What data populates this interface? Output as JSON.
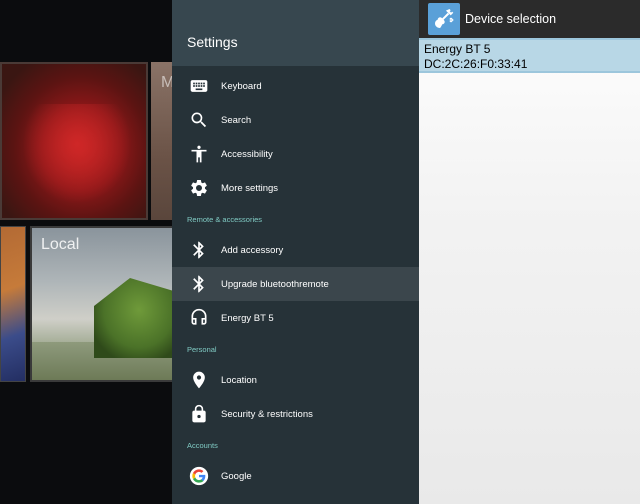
{
  "launcher": {
    "tile_music_letter": "M",
    "tile_local_label": "Local"
  },
  "settings": {
    "title": "Settings",
    "items": [
      {
        "label": "Keyboard",
        "icon": "keyboard-icon"
      },
      {
        "label": "Search",
        "icon": "search-icon"
      },
      {
        "label": "Accessibility",
        "icon": "accessibility-icon"
      },
      {
        "label": "More settings",
        "icon": "gear-icon"
      }
    ],
    "section_remote": "Remote & accessories",
    "remote_items": [
      {
        "label": "Add accessory",
        "icon": "bluetooth-icon"
      },
      {
        "label": "Upgrade bluetoothremote",
        "icon": "bluetooth-icon",
        "selected": true
      },
      {
        "label": "Energy BT 5",
        "icon": "headset-icon"
      }
    ],
    "section_personal": "Personal",
    "personal_items": [
      {
        "label": "Location",
        "icon": "location-pin-icon"
      },
      {
        "label": "Security & restrictions",
        "icon": "lock-icon"
      }
    ],
    "section_accounts": "Accounts",
    "account_items": [
      {
        "label": "Google",
        "icon": "google-icon"
      }
    ]
  },
  "dialog": {
    "title": "Device selection",
    "app_icon": "guitar-bluetooth-app-icon",
    "devices": [
      {
        "name": "Energy BT 5",
        "address": "DC:2C:26:F0:33:41",
        "selected": true
      }
    ]
  },
  "colors": {
    "settings_bg": "#263238",
    "settings_header_bg": "#37474f",
    "section_accent": "#80cbc4",
    "selected_row_bg": "#3b464c",
    "dialog_bar_bg": "#2b2b2b",
    "device_highlight": "#b8d7e6",
    "app_icon_bg": "#5aa0d8"
  }
}
